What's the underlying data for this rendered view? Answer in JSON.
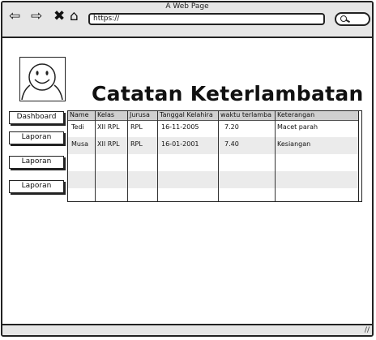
{
  "window": {
    "title": "A Web Page"
  },
  "browser": {
    "url": "https://",
    "nav_icons": [
      "back-arrow-icon",
      "forward-arrow-icon",
      "close-icon",
      "home-icon"
    ]
  },
  "page": {
    "title": "Catatan Keterlambatan",
    "avatar_icon": "user-avatar-icon"
  },
  "sidebar": {
    "items": [
      {
        "label": "Dashboard"
      },
      {
        "label": "Laporan"
      },
      {
        "label": "Laporan"
      },
      {
        "label": "Laporan"
      }
    ]
  },
  "table": {
    "columns": [
      "Name",
      "Kelas",
      "Jurusa",
      "Tanggal Kelahira",
      "waktu terlamba",
      "Keterangan"
    ],
    "rows": [
      [
        "Tedi",
        "XII RPL",
        "RPL",
        "16-11-2005",
        "7.20",
        "Macet parah"
      ],
      [
        "Musa",
        "XII RPL",
        "RPL",
        "16-01-2001",
        "7.40",
        "Kesiangan"
      ],
      [
        "",
        "",
        "",
        "",
        "",
        ""
      ],
      [
        "",
        "",
        "",
        "",
        "",
        ""
      ],
      [
        "",
        "",
        "",
        "",
        "",
        ""
      ]
    ]
  },
  "colors": {
    "row_alt": "#ebebeb",
    "header": "#cfcfcf",
    "chrome": "#e6e6e6"
  }
}
